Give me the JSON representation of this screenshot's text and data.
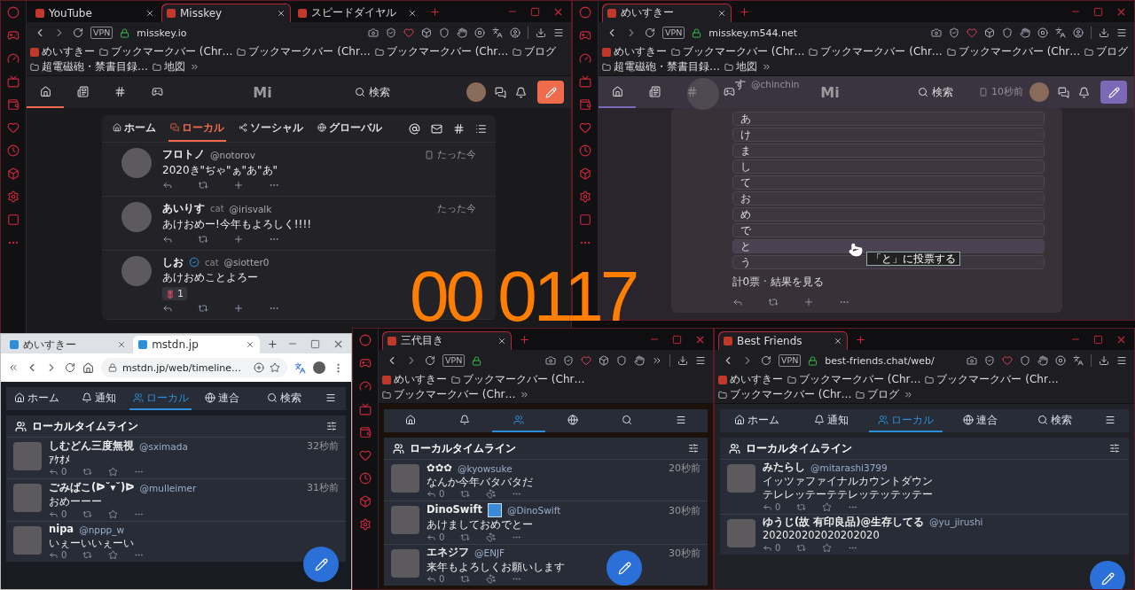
{
  "recording_timer": "00 0117",
  "windows": [
    {
      "kind": "opera",
      "sidebar": true,
      "vpn_badge": "VPN",
      "url": "misskey.io",
      "tabs": [
        {
          "title": "YouTube",
          "selected": false
        },
        {
          "title": "Misskey",
          "selected": true
        },
        {
          "title": "スピードダイヤル",
          "selected": false
        }
      ],
      "bookmarks": [
        {
          "label": "めいすきー",
          "kind": "site"
        },
        {
          "label": "ブックマークバー (Chr…",
          "kind": "folder"
        },
        {
          "label": "ブックマークバー (Chr…",
          "kind": "folder"
        },
        {
          "label": "ブックマークバー (Chr…",
          "kind": "folder"
        },
        {
          "label": "ブログ",
          "kind": "folder"
        },
        {
          "label": "超電磁砲・禁書目録…",
          "kind": "folder"
        },
        {
          "label": "地図",
          "kind": "folder"
        }
      ],
      "app": {
        "kind": "misskey",
        "logo": "Mi",
        "search": "検索",
        "nav": [
          {
            "selected": true
          },
          {
            "selected": false
          },
          {
            "selected": false
          },
          {
            "selected": false
          }
        ],
        "timeline_tabs": [
          {
            "label": "ホーム",
            "selected": false
          },
          {
            "label": "ローカル",
            "selected": true
          },
          {
            "label": "ソーシャル",
            "selected": false
          },
          {
            "label": "グローバル",
            "selected": false
          }
        ],
        "notes": [
          {
            "name": "フロトノ",
            "handle": "@notorov",
            "text": "2020き\"ぢゃ\"ぁ\"あ\"あ\"",
            "time": "たった今",
            "device": true
          },
          {
            "name": "あいりす",
            "badge": "cat",
            "handle": "@irisvalk",
            "text": "あけおめー!今年もよろしく!!!!",
            "time": "たった今"
          },
          {
            "name": "しお",
            "verified": true,
            "badge": "cat",
            "handle": "@siotter0",
            "text": "あけおめことよろー",
            "reactions": [
              {
                "count": "1"
              }
            ]
          }
        ]
      }
    },
    {
      "kind": "opera",
      "sidebar": true,
      "vpn_badge": "VPN",
      "url": "misskey.m544.net",
      "tabs": [
        {
          "title": "めいすきー",
          "selected": true
        }
      ],
      "bookmarks": [
        {
          "label": "めいすきー",
          "kind": "site"
        },
        {
          "label": "ブックマークバー (Chr…",
          "kind": "folder"
        },
        {
          "label": "ブックマークバー (Chr…",
          "kind": "folder"
        },
        {
          "label": "ブックマークバー (Chr…",
          "kind": "folder"
        },
        {
          "label": "ブログ",
          "kind": "folder"
        },
        {
          "label": "超電磁砲・禁書目録…",
          "kind": "folder"
        },
        {
          "label": "地図",
          "kind": "folder"
        }
      ],
      "app": {
        "kind": "misskey-poll",
        "logo": "Mi",
        "search": "検索",
        "nav": [
          {
            "selected": true
          },
          {
            "selected": false
          },
          {
            "selected": false
          },
          {
            "selected": false
          }
        ],
        "ghost_note": {
          "name": "す",
          "handle": "@chinchin",
          "time": "10秒前"
        },
        "poll": {
          "choices": [
            {
              "label": "あ",
              "hovered": false
            },
            {
              "label": "け",
              "hovered": false
            },
            {
              "label": "ま",
              "hovered": false
            },
            {
              "label": "し",
              "hovered": false
            },
            {
              "label": "て",
              "hovered": false
            },
            {
              "label": "お",
              "hovered": false
            },
            {
              "label": "め",
              "hovered": false
            },
            {
              "label": "で",
              "hovered": false
            },
            {
              "label": "と",
              "hovered": true
            },
            {
              "label": "う",
              "hovered": false
            }
          ],
          "tooltip": "「と」に投票する",
          "summary": "計0票 · 結果を見る"
        }
      }
    },
    {
      "kind": "chrome",
      "sidebar": false,
      "url": "mstdn.jp/web/timeline…",
      "tabs": [
        {
          "title": "めいすきー",
          "selected": false
        },
        {
          "title": "mstdn.jp",
          "selected": true
        }
      ],
      "app": {
        "kind": "mastodon",
        "favourite": {
          "kind": "star"
        },
        "compose": true,
        "nav": [
          {
            "label": "ホーム",
            "selected": false
          },
          {
            "label": "通知",
            "selected": false
          },
          {
            "label": "ローカル",
            "selected": true
          },
          {
            "label": "連合",
            "selected": false
          },
          {
            "label": "検索",
            "selected": false
          },
          {
            "selected": false
          }
        ],
        "column_title": "ローカルタイムライン",
        "toots": [
          {
            "name": "しむどん三度無視",
            "handle": "@sximada",
            "time": "32秒前",
            "text": [
              "ｱｹｵﾒ"
            ],
            "replies": "0"
          },
          {
            "name": "ごみばこ(ᐅ˘▾˘)ᐅ",
            "handle": "@mulleimer",
            "time": "31秒前",
            "text": [
              "おめーーー"
            ],
            "replies": "0"
          },
          {
            "name": "nipa",
            "handle": "@nppp_w",
            "text": [
              "いぇーいいぇーい"
            ],
            "replies": "0"
          }
        ]
      }
    },
    {
      "kind": "opera",
      "sidebar": true,
      "vpn_badge": "VPN",
      "tabs": [
        {
          "title": "三代目き",
          "selected": true
        }
      ],
      "bookmarks": [
        {
          "label": "めいすきー",
          "kind": "site"
        },
        {
          "label": "ブックマークバー (Chr…",
          "kind": "folder"
        },
        {
          "label": "ブックマークバー (Chr…",
          "kind": "folder"
        }
      ],
      "app": {
        "kind": "mastodon",
        "favourite": {
          "kind": "paw"
        },
        "compose": true,
        "nav": [
          {
            "selected": false
          },
          {
            "selected": false
          },
          {
            "selected": true
          },
          {
            "selected": false
          },
          {
            "selected": false
          },
          {
            "selected": false
          }
        ],
        "column_title": "ローカルタイムライン",
        "toots": [
          {
            "name": "✿✿✿",
            "handle": "@kyowsuke",
            "time": "20秒前",
            "text": [
              "なんか今年バタバタだ"
            ],
            "replies": "0"
          },
          {
            "name": "DinoSwift",
            "emoji": true,
            "handle": "@DinoSwift",
            "time": "30秒前",
            "text": [
              "あけましておめでとー"
            ],
            "replies": "0"
          },
          {
            "name": "エネジフ",
            "handle": "@ENJF",
            "time": "30秒前",
            "text": [
              "来年もよろしくお願いします"
            ],
            "replies": "0"
          }
        ]
      }
    },
    {
      "kind": "opera",
      "sidebar": false,
      "vpn_badge": "VPN",
      "url": "best-friends.chat/web/",
      "tabs": [
        {
          "title": "Best Friends",
          "selected": true
        }
      ],
      "bookmarks": [
        {
          "label": "めいすきー",
          "kind": "site"
        },
        {
          "label": "ブックマークバー (Chr…",
          "kind": "folder"
        },
        {
          "label": "ブックマークバー (Chr…",
          "kind": "folder"
        },
        {
          "label": "ブックマークバー (Chr…",
          "kind": "folder"
        },
        {
          "label": "ブログ",
          "kind": "folder"
        }
      ],
      "app": {
        "kind": "mastodon",
        "favourite": {
          "kind": "star"
        },
        "compose": true,
        "nav": [
          {
            "label": "ホーム",
            "selected": false
          },
          {
            "label": "通知",
            "selected": false
          },
          {
            "label": "ローカル",
            "selected": true
          },
          {
            "label": "連合",
            "selected": false
          },
          {
            "label": "検索",
            "selected": false
          },
          {
            "selected": false
          }
        ],
        "column_title": "ローカルタイムライン",
        "toots": [
          {
            "name": "みたらし",
            "handle": "@mitarashi3799",
            "text": [
              "イッツァファイナルカウントダウン",
              "テレレッテーテテレッテッテッテー"
            ],
            "replies": "0"
          },
          {
            "name": "ゆうじ(故 有印良品)@生存してる",
            "handle": "@yu_jirushi",
            "text": [
              "202020202020202020"
            ],
            "replies": "0"
          }
        ]
      }
    }
  ]
}
